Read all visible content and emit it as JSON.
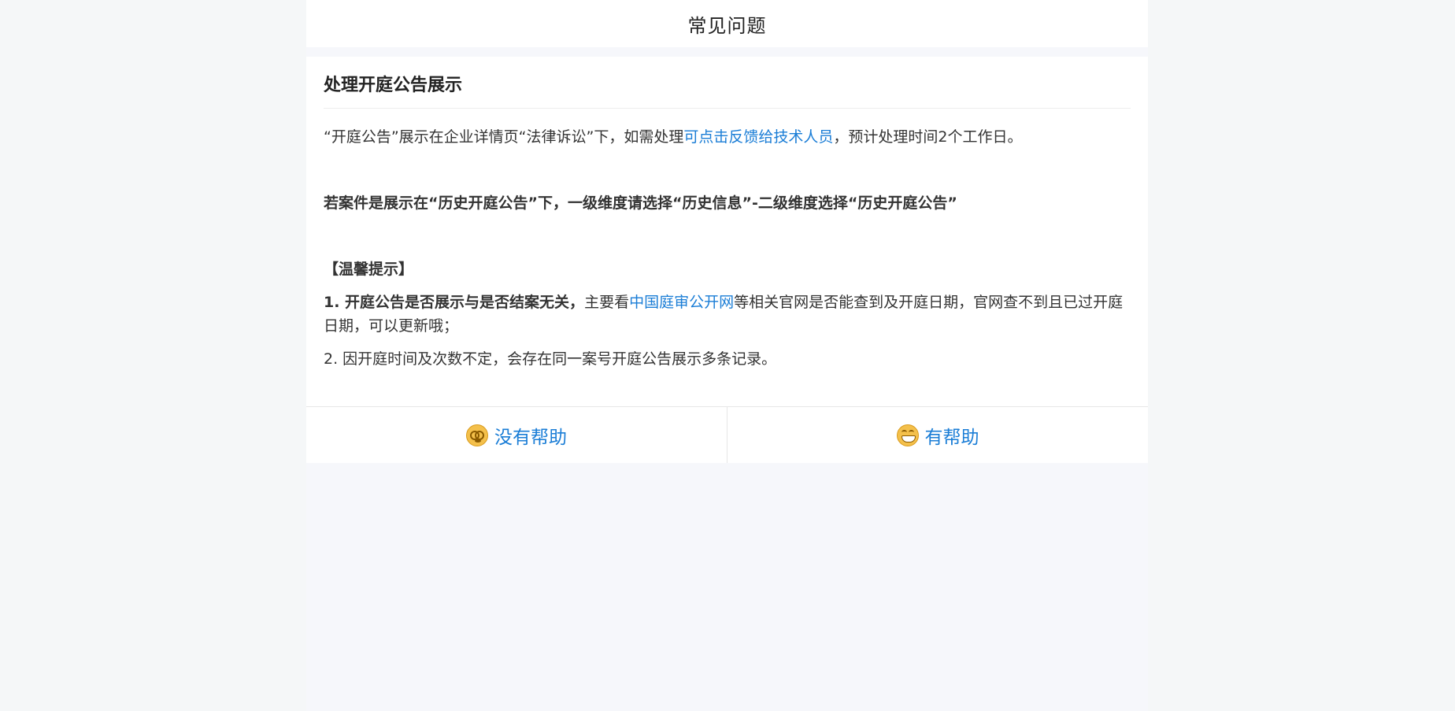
{
  "header": {
    "title": "常见问题"
  },
  "article": {
    "title": "处理开庭公告展示",
    "intro": {
      "before": "“开庭公告”展示在企业详情页“法律诉讼”下，如需处理",
      "link": "可点击反馈给技术人员",
      "after": "，预计处理时间2个工作日。"
    },
    "bold_note": "若案件是展示在“历史开庭公告”下，一级维度请选择“历史信息”-二级维度选择“历史开庭公告”",
    "tips_heading": "【温馨提示】",
    "tip1": {
      "bold": "1. 开庭公告是否展示与是否结案无关，",
      "before": "主要看",
      "link": "中国庭审公开网",
      "after": "等相关官网是否能查到及开庭日期，官网查不到且已过开庭日期，可以更新哦；"
    },
    "tip2": "2. 因开庭时间及次数不定，会存在同一案号开庭公告展示多条记录。"
  },
  "feedback": {
    "not_helpful": {
      "label": "没有帮助",
      "icon": "dizzy-face-icon"
    },
    "helpful": {
      "label": "有帮助",
      "icon": "grinning-face-icon"
    }
  },
  "colors": {
    "link": "#1a7dd6",
    "background": "#f5f7f8",
    "card": "#ffffff"
  }
}
